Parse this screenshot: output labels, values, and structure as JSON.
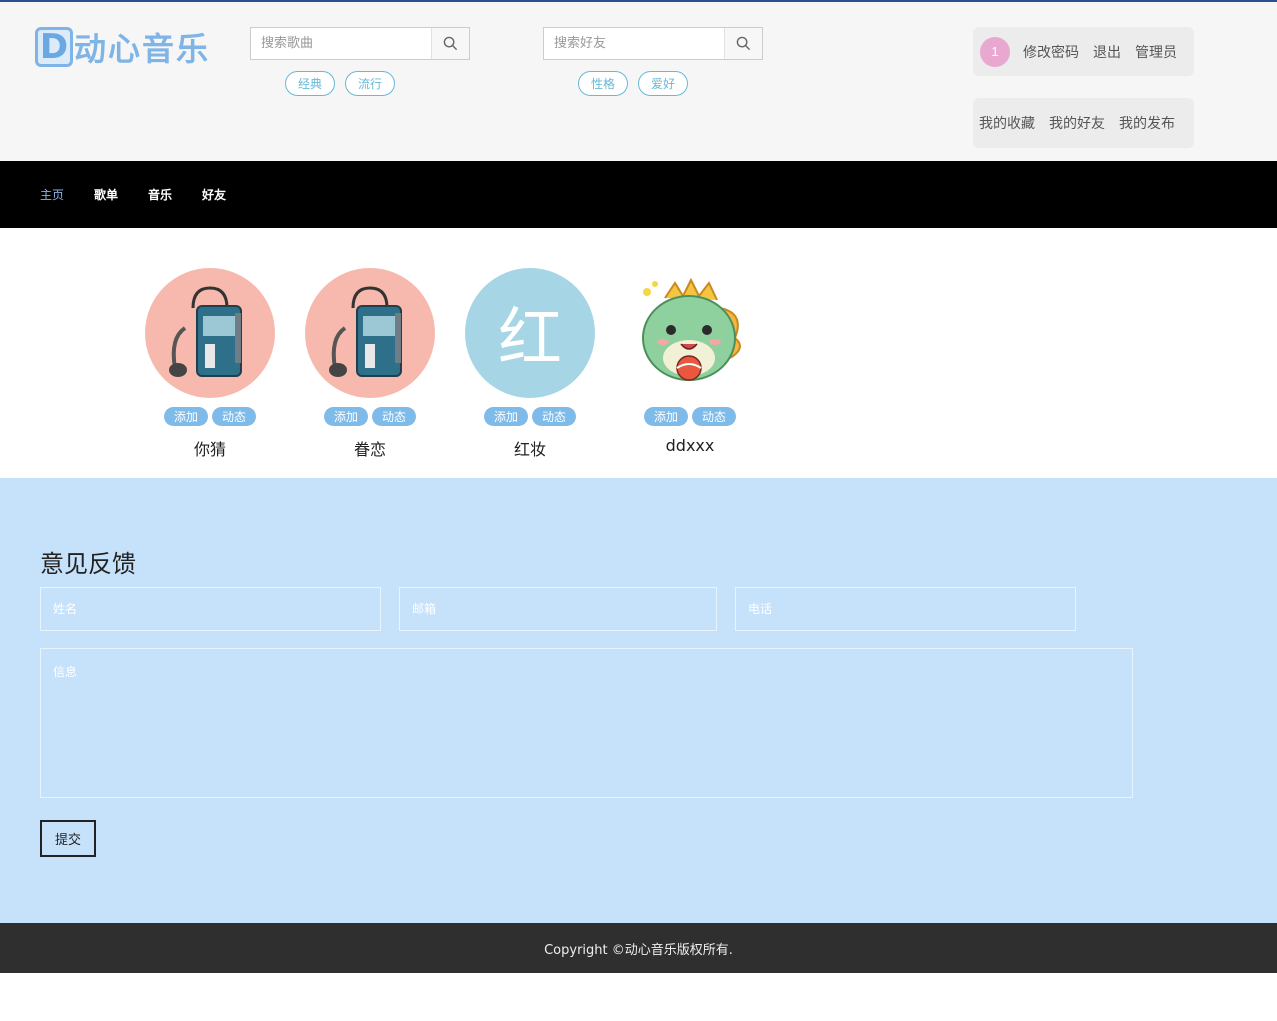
{
  "header": {
    "logo_letter": "D",
    "logo_text": "动心音乐",
    "song_search": {
      "placeholder": "搜索歌曲",
      "tags": [
        "经典",
        "流行"
      ]
    },
    "friend_search": {
      "placeholder": "搜索好友",
      "tags": [
        "性格",
        "爱好"
      ]
    },
    "user": {
      "badge": "1",
      "change_password": "修改密码",
      "logout": "退出",
      "admin": "管理员"
    },
    "my_links": [
      "我的收藏",
      "我的好友",
      "我的发布"
    ]
  },
  "nav": {
    "items": [
      "主页",
      "歌单",
      "音乐",
      "好友"
    ],
    "active": "主页"
  },
  "friends": {
    "add_label": "添加",
    "feed_label": "动态",
    "list": [
      {
        "name": "你猜",
        "avatar": "cassette-player-icon"
      },
      {
        "name": "眷恋",
        "avatar": "cassette-player-icon"
      },
      {
        "name": "红妆",
        "avatar_char": "红"
      },
      {
        "name": "ddxxx",
        "avatar": "dragon-mascot-icon"
      }
    ]
  },
  "feedback": {
    "title": "意见反馈",
    "name_placeholder": "姓名",
    "email_placeholder": "邮箱",
    "phone_placeholder": "电话",
    "message_placeholder": "信息",
    "submit": "提交"
  },
  "footer": {
    "text": "Copyright ©动心音乐版权所有."
  },
  "colors": {
    "accent": "#7fb4e6",
    "nav_bg": "#000000",
    "feedback_bg": "#c6e2fb",
    "footer_bg": "#2f2f2f",
    "badge": "#e8a8cf"
  }
}
